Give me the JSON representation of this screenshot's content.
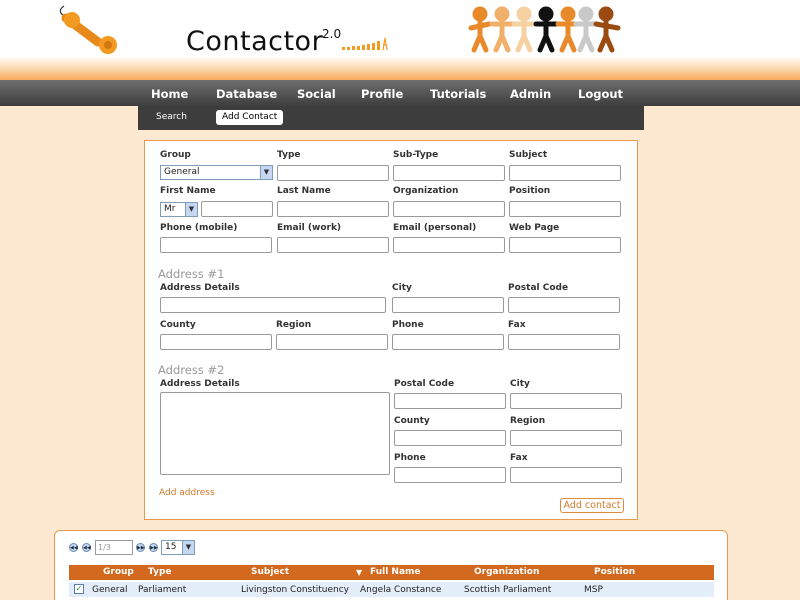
{
  "app": {
    "logo_text": "Contactor",
    "version": "2.0"
  },
  "nav": {
    "items": [
      "Home",
      "Database",
      "Social",
      "Profile",
      "Tutorials",
      "Admin",
      "Logout"
    ]
  },
  "subnav": {
    "search": "Search",
    "add_contact": "Add Contact"
  },
  "form": {
    "group_label": "Group",
    "group_value": "General",
    "type_label": "Type",
    "subtype_label": "Sub-Type",
    "subject_label": "Subject",
    "first_name_label": "First Name",
    "title_value": "Mr",
    "last_name_label": "Last Name",
    "organization_label": "Organization",
    "position_label": "Position",
    "phone_mobile_label": "Phone (mobile)",
    "email_work_label": "Email (work)",
    "email_personal_label": "Email (personal)",
    "web_page_label": "Web Page",
    "address1": {
      "heading": "Address #1",
      "details_label": "Address Details",
      "city_label": "City",
      "postal_label": "Postal Code",
      "county_label": "County",
      "region_label": "Region",
      "phone_label": "Phone",
      "fax_label": "Fax"
    },
    "address2": {
      "heading": "Address #2",
      "details_label": "Address Details",
      "postal_label": "Postal Code",
      "city_label": "City",
      "county_label": "County",
      "region_label": "Region",
      "phone_label": "Phone",
      "fax_label": "Fax"
    },
    "add_address": "Add address",
    "add_contact_button": "Add contact"
  },
  "pager": {
    "page_placeholder": "1/3",
    "per_page": "15"
  },
  "table": {
    "columns": [
      "Group",
      "Type",
      "Subject",
      "Full Name",
      "Organization",
      "Position"
    ],
    "sort_indicator": "▼",
    "rows": [
      {
        "group": "General",
        "type": "Parliament",
        "subject": "Livingston Constituency",
        "full_name": "Angela Constance",
        "organization": "Scottish Parliament",
        "position": "MSP"
      }
    ]
  },
  "colors": {
    "accent": "#d2691e",
    "background": "#fde9d2",
    "nav": "#4a4a4a"
  }
}
